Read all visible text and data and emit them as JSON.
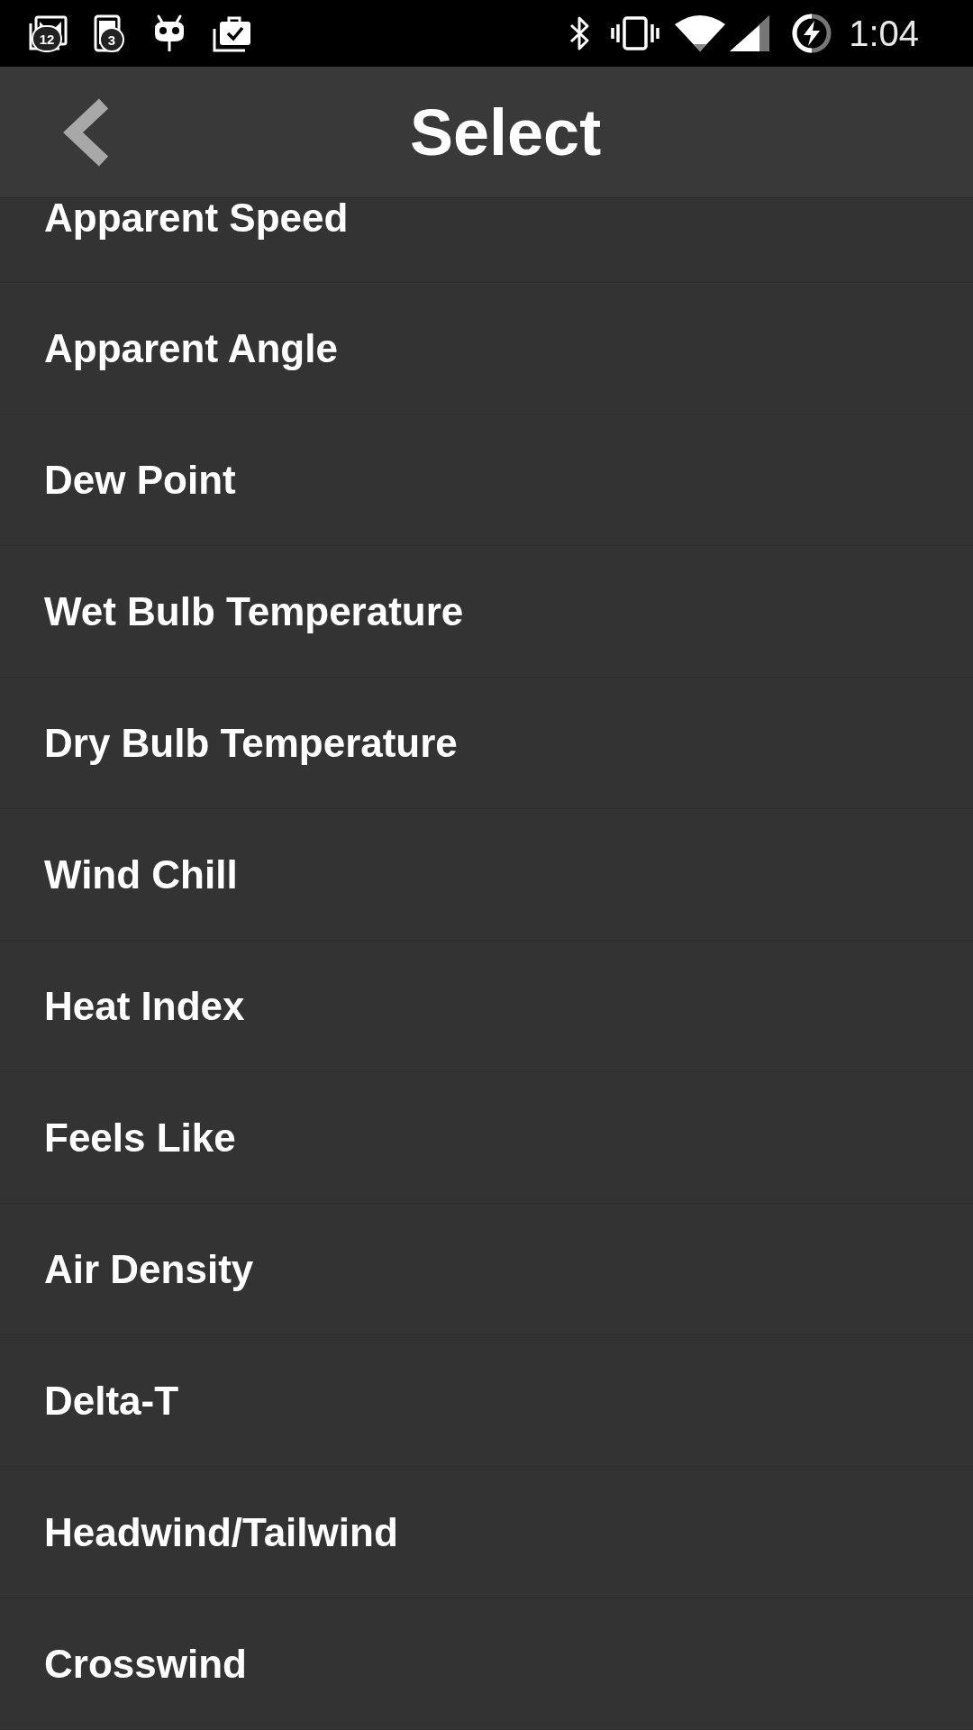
{
  "status_bar": {
    "notifications": [
      {
        "kind": "gallery",
        "badge": "12"
      },
      {
        "kind": "phone",
        "badge": "3"
      },
      {
        "kind": "mascot"
      },
      {
        "kind": "clipboard"
      }
    ],
    "time": "1:04"
  },
  "header": {
    "title": "Select"
  },
  "items": [
    {
      "label": "Apparent Speed"
    },
    {
      "label": "Apparent Angle"
    },
    {
      "label": "Dew Point"
    },
    {
      "label": "Wet Bulb Temperature"
    },
    {
      "label": "Dry Bulb Temperature"
    },
    {
      "label": "Wind Chill"
    },
    {
      "label": "Heat Index"
    },
    {
      "label": "Feels Like"
    },
    {
      "label": "Air Density"
    },
    {
      "label": "Delta-T"
    },
    {
      "label": "Headwind/Tailwind"
    },
    {
      "label": "Crosswind"
    }
  ]
}
